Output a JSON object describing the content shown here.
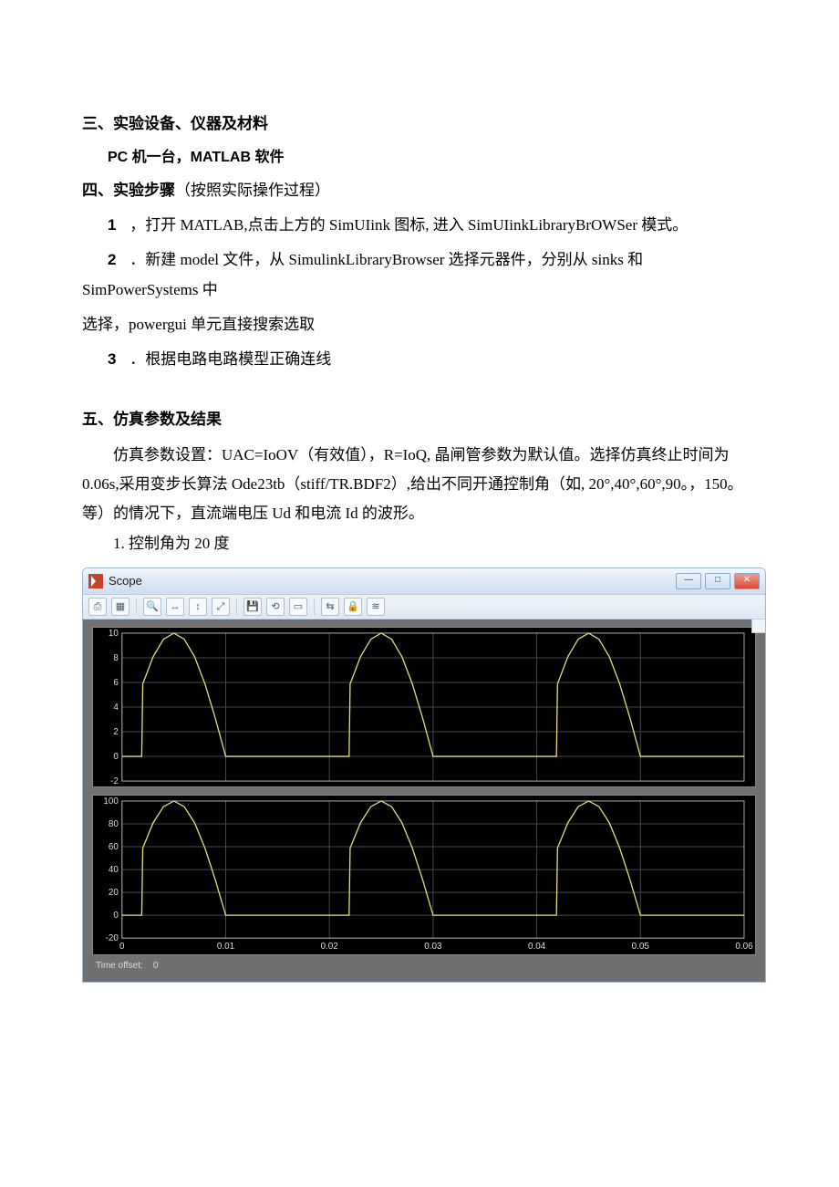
{
  "sections": {
    "three": {
      "heading": "三、实验设备、仪器及材料",
      "sub": "PC 机一台，MATLAB 软件"
    },
    "four": {
      "heading": "四、实验步骤",
      "heading_note": "（按照实际操作过程）",
      "steps": {
        "s1_num": "1",
        "s1_text": " ，打开 MATLAB,点击上方的 SimUIink 图标, 进入 SimUIinkLibraryBrOWSer 模式。",
        "s2_num": "2",
        "s2_text": " ．新建 model 文件，从 SimulinkLibraryBrowser 选择元器件，分别从 sinks 和 SimPowerSystems 中",
        "s2_cont": "选择，powergui 单元直接搜索选取",
        "s3_num": "3",
        "s3_text": " ．根据电路电路模型正确连线"
      }
    },
    "five": {
      "heading": "五、仿真参数及结果",
      "para": "仿真参数设置：UAC=IoOV（有效值），R=IoQ, 晶闸管参数为默认值。选择仿真终止时间为0.06s,采用变步长算法 Ode23tb（stiff/TR.BDF2）,给出不同开通控制角（如, 20°,40°,60°,90。，150。等）的情况下，直流端电压 Ud 和电流 Id 的波形。",
      "item1": "1. 控制角为 20 度"
    }
  },
  "scope": {
    "title": "Scope",
    "time_offset_label": "Time offset:",
    "time_offset_value": "0"
  },
  "chart_data": [
    {
      "type": "line",
      "title": "",
      "xlabel": "",
      "ylabel": "",
      "xlim": [
        0,
        0.06
      ],
      "ylim": [
        -2,
        10
      ],
      "yticks": [
        -2,
        0,
        2,
        4,
        6,
        8,
        10
      ],
      "xticks": [
        0,
        0.01,
        0.02,
        0.03,
        0.04,
        0.05,
        0.06
      ],
      "series": [
        {
          "name": "Id",
          "period": 0.02,
          "firing_angle_deg": 20,
          "peak": 10,
          "x": [
            0,
            0.00111,
            0.002,
            0.003,
            0.004,
            0.005,
            0.006,
            0.007,
            0.008,
            0.009,
            0.01
          ],
          "y": [
            0,
            0,
            5.88,
            8.09,
            9.51,
            10.0,
            9.51,
            8.09,
            5.88,
            3.09,
            0
          ]
        }
      ]
    },
    {
      "type": "line",
      "title": "",
      "xlabel": "",
      "ylabel": "",
      "xlim": [
        0,
        0.06
      ],
      "ylim": [
        -20,
        100
      ],
      "yticks": [
        -20,
        0,
        20,
        40,
        60,
        80,
        100
      ],
      "xticks": [
        0,
        0.01,
        0.02,
        0.03,
        0.04,
        0.05,
        0.06
      ],
      "series": [
        {
          "name": "Ud",
          "period": 0.02,
          "firing_angle_deg": 20,
          "peak": 100,
          "x": [
            0,
            0.00111,
            0.002,
            0.003,
            0.004,
            0.005,
            0.006,
            0.007,
            0.008,
            0.009,
            0.01
          ],
          "y": [
            0,
            0,
            58.8,
            80.9,
            95.1,
            100.0,
            95.1,
            80.9,
            58.8,
            30.9,
            0
          ]
        }
      ]
    }
  ]
}
